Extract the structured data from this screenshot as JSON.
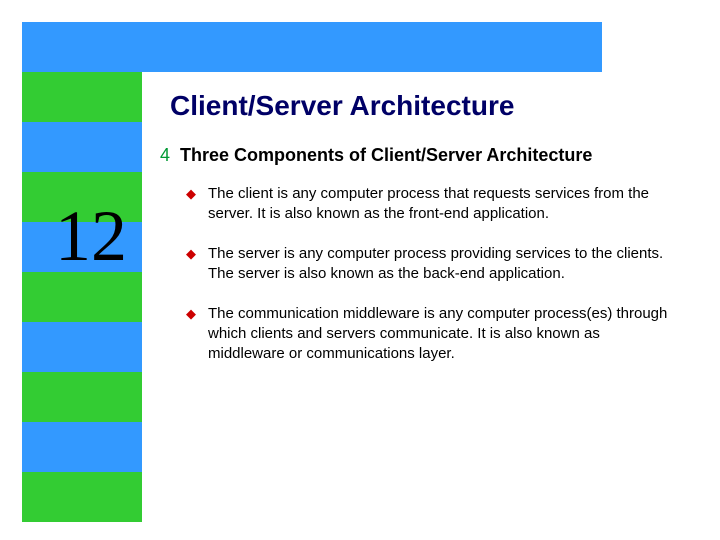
{
  "slide": {
    "title": "Client/Server Architecture",
    "number": "12",
    "main_bullet": "Three Components of Client/Server Architecture",
    "sub_bullets": [
      "The client is any computer process that requests services from the server. It is also known as the front-end application.",
      "The server is any computer process providing services to the clients. The server is also known as the back-end application.",
      "The communication middleware is any computer process(es) through which clients and servers communicate. It is also known as middleware or communications layer."
    ]
  },
  "colors": {
    "blue": "#3399ff",
    "green": "#33cc33",
    "title": "#000066",
    "main_bullet_icon": "#009933",
    "sub_bullet_icon": "#cc0000"
  }
}
